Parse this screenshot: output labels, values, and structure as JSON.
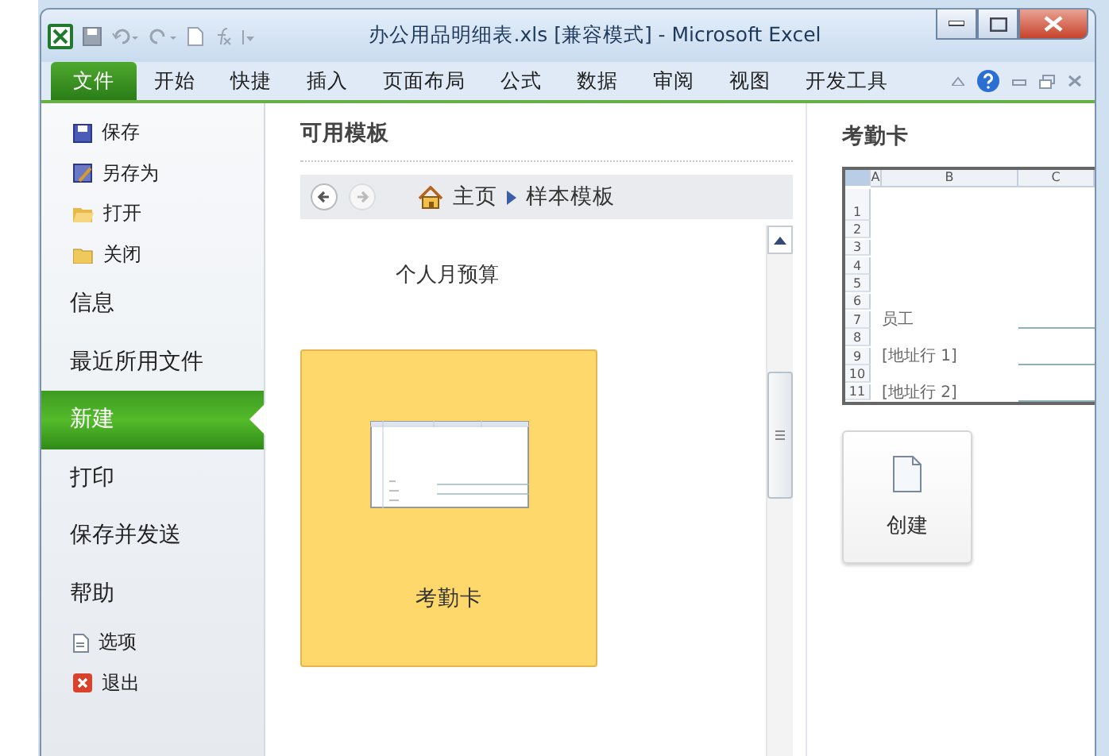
{
  "window": {
    "title": "办公用品明细表.xls  [兼容模式]  -  Microsoft Excel"
  },
  "ribbon_tabs": [
    {
      "label": "文件",
      "selected": true
    },
    {
      "label": "开始",
      "selected": false
    },
    {
      "label": "快捷",
      "selected": false
    },
    {
      "label": "插入",
      "selected": false
    },
    {
      "label": "页面布局",
      "selected": false
    },
    {
      "label": "公式",
      "selected": false
    },
    {
      "label": "数据",
      "selected": false
    },
    {
      "label": "审阅",
      "selected": false
    },
    {
      "label": "视图",
      "selected": false
    },
    {
      "label": "开发工具",
      "selected": false
    }
  ],
  "sidebar": {
    "items": [
      {
        "label": "保存",
        "kind": "command",
        "selected": false
      },
      {
        "label": "另存为",
        "kind": "command",
        "selected": false
      },
      {
        "label": "打开",
        "kind": "command",
        "selected": false
      },
      {
        "label": "关闭",
        "kind": "command",
        "selected": false
      },
      {
        "label": "信息",
        "kind": "page",
        "selected": false
      },
      {
        "label": "最近所用文件",
        "kind": "page",
        "selected": false
      },
      {
        "label": "新建",
        "kind": "page",
        "selected": true
      },
      {
        "label": "打印",
        "kind": "page",
        "selected": false
      },
      {
        "label": "保存并发送",
        "kind": "page",
        "selected": false
      },
      {
        "label": "帮助",
        "kind": "page",
        "selected": false
      },
      {
        "label": "选项",
        "kind": "command",
        "selected": false
      },
      {
        "label": "退出",
        "kind": "command",
        "selected": false
      }
    ]
  },
  "templates": {
    "heading": "可用模板",
    "breadcrumb": [
      "主页",
      "样本模板"
    ],
    "items": [
      {
        "label": "个人月预算",
        "selected": false,
        "kind": "text"
      },
      {
        "label": "考勤卡",
        "selected": true,
        "kind": "thumbnail"
      }
    ]
  },
  "preview": {
    "title": "考勤卡",
    "columns": [
      "A",
      "B",
      "C"
    ],
    "rows": [
      {
        "number": "1",
        "text": ""
      },
      {
        "number": "2",
        "text": ""
      },
      {
        "number": "3",
        "text": ""
      },
      {
        "number": "4",
        "text": ""
      },
      {
        "number": "5",
        "text": ""
      },
      {
        "number": "6",
        "text": ""
      },
      {
        "number": "7",
        "text": "员工"
      },
      {
        "number": "8",
        "text": ""
      },
      {
        "number": "9",
        "text": "[地址行 1]"
      },
      {
        "number": "10",
        "text": ""
      },
      {
        "number": "11",
        "text": "[地址行 2]"
      }
    ],
    "create_label": "创建"
  }
}
